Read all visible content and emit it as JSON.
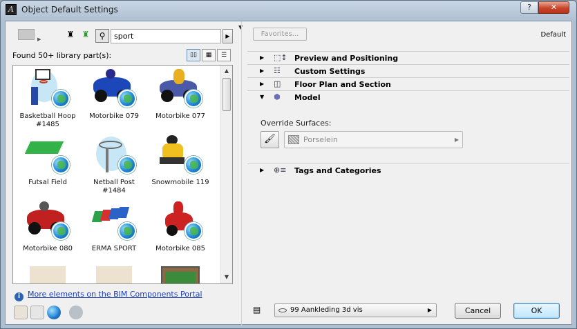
{
  "window": {
    "title": "Object Default Settings",
    "help_label": "?",
    "close_label": "✕"
  },
  "library": {
    "search": {
      "value": "sport",
      "placeholder": ""
    },
    "found_label": "Found 50+ library part(s):",
    "items": [
      {
        "label": "Basketball Hoop #1485",
        "icon": "basketball-hoop"
      },
      {
        "label": "Motorbike 079",
        "icon": "motorbike-blue"
      },
      {
        "label": "Motorbike 077",
        "icon": "motorbike-rider"
      },
      {
        "label": "Futsal Field",
        "icon": "futsal-field"
      },
      {
        "label": "Netball Post #1484",
        "icon": "netball-post"
      },
      {
        "label": "Snowmobile 119",
        "icon": "snowmobile"
      },
      {
        "label": "Motorbike 080",
        "icon": "motorbike-red"
      },
      {
        "label": "ERMA SPORT",
        "icon": "erma-logo"
      },
      {
        "label": "Motorbike 085",
        "icon": "motorbike-red-rider"
      },
      {
        "label": "",
        "icon": "thumb-partial"
      },
      {
        "label": "",
        "icon": "thumb-partial"
      },
      {
        "label": "",
        "icon": "foosball-table"
      }
    ],
    "portal_link": "More elements on the BIM Components Portal"
  },
  "settings": {
    "favorites_label": "Favorites...",
    "default_label": "Default",
    "panels": [
      {
        "label": "Preview and Positioning",
        "expanded": false,
        "icon": "preview-icon"
      },
      {
        "label": "Custom Settings",
        "expanded": false,
        "icon": "custom-settings-icon"
      },
      {
        "label": "Floor Plan and Section",
        "expanded": false,
        "icon": "floor-plan-icon"
      },
      {
        "label": "Model",
        "expanded": true,
        "icon": "model-cube-icon"
      },
      {
        "label": "Tags and Categories",
        "expanded": false,
        "icon": "tags-icon"
      }
    ],
    "override_surfaces_label": "Override Surfaces:",
    "surface_value": "Porselein",
    "layer_value": "99 Aankleding 3d vis",
    "cancel_label": "Cancel",
    "ok_label": "OK"
  },
  "colors": {
    "accent": "#3c7fb1",
    "link": "#1a3fb8",
    "close": "#c8452a"
  }
}
